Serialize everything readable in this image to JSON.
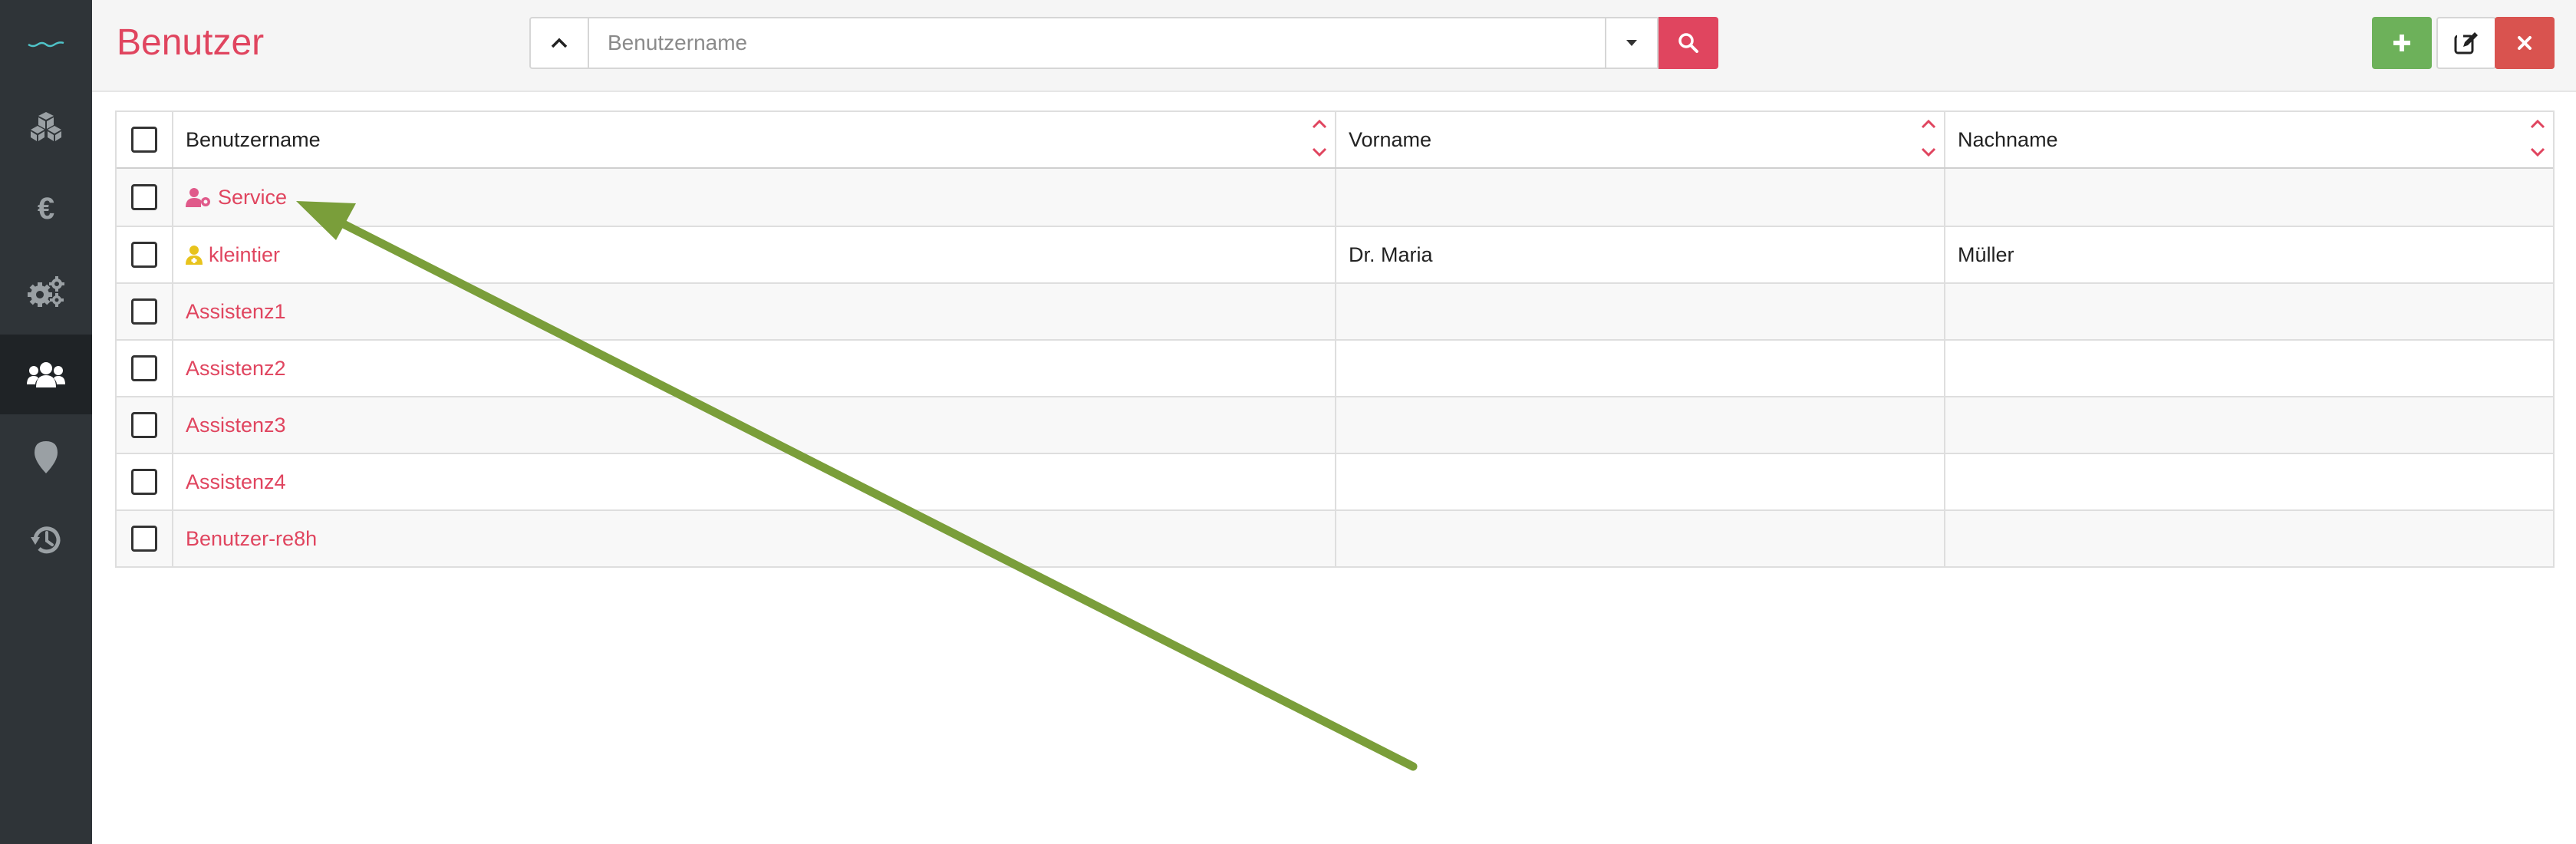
{
  "page": {
    "title": "Benutzer"
  },
  "sidebar": {
    "items": [
      {
        "name": "logo",
        "icon": "logo-wave-icon"
      },
      {
        "name": "modules",
        "icon": "cubes-icon"
      },
      {
        "name": "finance",
        "icon": "euro-icon"
      },
      {
        "name": "settings",
        "icon": "gears-icon"
      },
      {
        "name": "users",
        "icon": "users-icon",
        "active": true
      },
      {
        "name": "locations",
        "icon": "map-marker-icon"
      },
      {
        "name": "history",
        "icon": "history-icon"
      }
    ]
  },
  "search": {
    "placeholder": "Benutzername",
    "value": ""
  },
  "table": {
    "headers": {
      "username": "Benutzername",
      "firstname": "Vorname",
      "lastname": "Nachname"
    },
    "rows": [
      {
        "username": "Service",
        "firstname": "",
        "lastname": "",
        "icon": "user-cog-icon"
      },
      {
        "username": "kleintier",
        "firstname": "Dr. Maria",
        "lastname": "Müller",
        "icon": "user-doctor-icon"
      },
      {
        "username": "Assistenz1",
        "firstname": "",
        "lastname": ""
      },
      {
        "username": "Assistenz2",
        "firstname": "",
        "lastname": ""
      },
      {
        "username": "Assistenz3",
        "firstname": "",
        "lastname": ""
      },
      {
        "username": "Assistenz4",
        "firstname": "",
        "lastname": ""
      },
      {
        "username": "Benutzer-re8h",
        "firstname": "",
        "lastname": ""
      }
    ]
  },
  "colors": {
    "accent": "#e0455f",
    "sidebar": "#2f3438",
    "add": "#6db15a",
    "close": "#d9534f",
    "annotation_arrow": "#7a9e3a",
    "service_icon": "#e05a8a",
    "doctor_icon": "#e8c31c"
  }
}
